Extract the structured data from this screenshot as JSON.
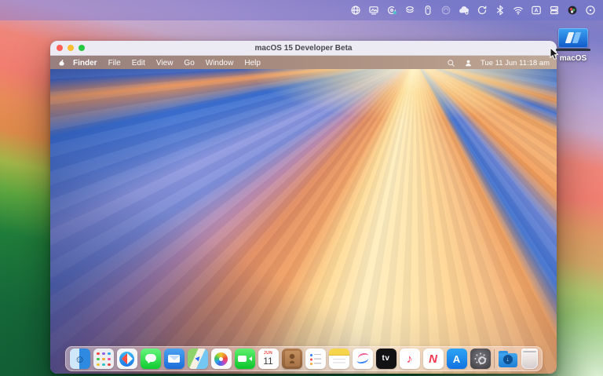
{
  "host": {
    "menubar": {
      "icons": [
        {
          "name": "globe-icon"
        },
        {
          "name": "display-mirroring-icon"
        },
        {
          "name": "swirl-app-icon"
        },
        {
          "name": "layers-icon"
        },
        {
          "name": "battery-case-icon"
        },
        {
          "name": "dimmed-app-icon"
        },
        {
          "name": "cloud-app-icon"
        },
        {
          "name": "sync-icon"
        },
        {
          "name": "bluetooth-icon"
        },
        {
          "name": "wifi-icon"
        },
        {
          "name": "input-source-icon",
          "text": "A"
        },
        {
          "name": "stacked-disks-icon"
        },
        {
          "name": "color-status-icon"
        },
        {
          "name": "control-center-icon"
        }
      ]
    },
    "desktop_icon": {
      "label": "macOS"
    }
  },
  "vm_window": {
    "title": "macOS 15 Developer Beta",
    "menubar": {
      "menus": [
        "Finder",
        "File",
        "Edit",
        "View",
        "Go",
        "Window",
        "Help"
      ],
      "status_icons": [
        {
          "name": "spotlight-search-icon"
        },
        {
          "name": "user-switching-icon"
        }
      ],
      "clock": "Tue 11 Jun  11:18 am"
    },
    "dock": {
      "items": [
        {
          "key": "finder",
          "name": "finder",
          "glyph": "☺"
        },
        {
          "key": "launchpad",
          "name": "launchpad"
        },
        {
          "key": "safari",
          "name": "safari"
        },
        {
          "key": "messages",
          "name": "messages"
        },
        {
          "key": "mail",
          "name": "mail"
        },
        {
          "key": "maps",
          "name": "maps",
          "glyph": "▲"
        },
        {
          "key": "photos",
          "name": "photos"
        },
        {
          "key": "facetime",
          "name": "facetime"
        },
        {
          "key": "calendar",
          "name": "calendar",
          "month": "JUN",
          "day": "11"
        },
        {
          "key": "contacts",
          "name": "contacts"
        },
        {
          "key": "reminders",
          "name": "reminders"
        },
        {
          "key": "notes",
          "name": "notes"
        },
        {
          "key": "freeform",
          "name": "freeform"
        },
        {
          "key": "appletv",
          "name": "apple-tv",
          "text": "tv"
        },
        {
          "key": "music",
          "name": "music",
          "glyph": "♪"
        },
        {
          "key": "news",
          "name": "news",
          "text": "N"
        },
        {
          "key": "appstore",
          "name": "app-store",
          "text": "A"
        },
        {
          "key": "settings",
          "name": "system-settings"
        },
        {
          "key": "separator"
        },
        {
          "key": "folder",
          "name": "downloads-folder",
          "glyph": "↓"
        },
        {
          "key": "trash",
          "name": "trash"
        }
      ]
    }
  },
  "colors": {
    "host_menubar_tint": "#8a7fc8",
    "vm_titlebar": "#eceaf2",
    "vm_menubar_left": "#97807f",
    "vm_menubar_right": "#bfa897",
    "traffic_red": "#ff5f57",
    "traffic_yellow": "#febc2e",
    "traffic_green": "#28c840",
    "sequoia_blue": "#3a6fd0",
    "sequoia_orange": "#f0a05c",
    "sequoia_yellow": "#ffedbc"
  }
}
